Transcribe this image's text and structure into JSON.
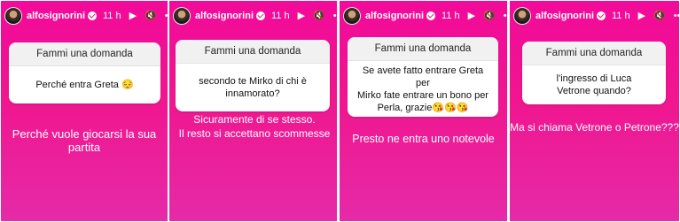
{
  "stories": [
    {
      "username": "alfosignorini",
      "time": "11 h",
      "header": "Fammi una domanda",
      "question": "Perché entra Greta 😔",
      "answer": "Perché  vuole giocarsi  la sua partita"
    },
    {
      "username": "alfosignorini",
      "time": "11 h",
      "header": "Fammi una domanda",
      "question": "secondo te Mirko di chi è\ninnamorato?",
      "answer": "Sicuramente di se stesso.\nIl resto si accettano scommesse"
    },
    {
      "username": "alfosignorini",
      "time": "11 h",
      "header": "Fammi una domanda",
      "question": "Se avete fatto entrare Greta per\nMirko fate entrare un bono per\nPerla, grazie😘😘😘",
      "answer": "Presto ne entra uno notevole"
    },
    {
      "username": "alfosignorini",
      "time": "11 h",
      "header": "Fammi una domanda",
      "question": "l'ingresso di Luca\nVetrone quando?",
      "answer": "Ma si chiama Vetrone o Petrone???"
    }
  ],
  "icons": {
    "play": "▶",
    "mute": "🔇",
    "more": "•••"
  },
  "colors": {
    "background": "#f20a9a",
    "question_header_bg": "#f1f1f1",
    "text_on_story": "#ffffff"
  }
}
